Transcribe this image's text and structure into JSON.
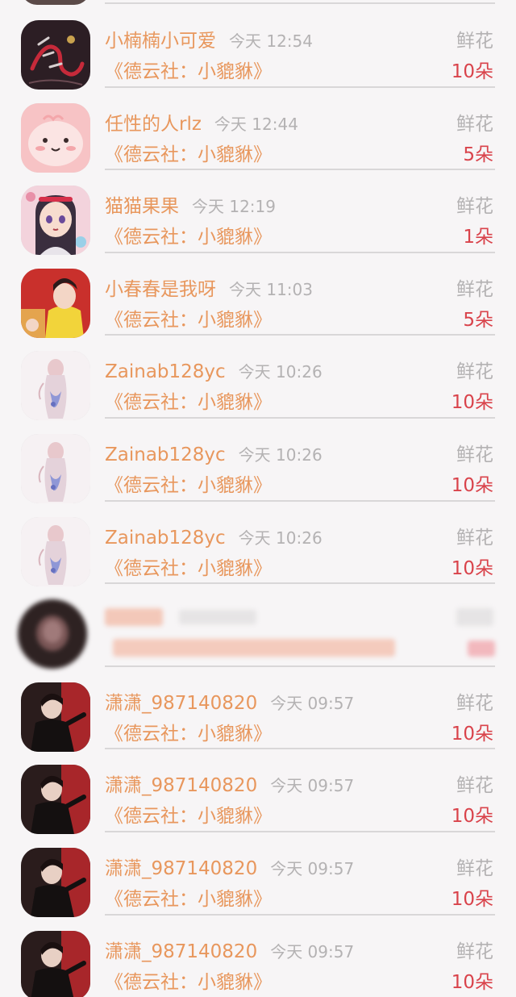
{
  "list": {
    "items": [
      {
        "name": "小楠楠小可爱",
        "time": "今天 12:54",
        "gift": "鲜花",
        "book": "《德云社：小貔貅》",
        "count": "10朵",
        "avatar_icon": "ink-calligraphy-avatar",
        "avatar_color": "#2c1e24"
      },
      {
        "name": "任性的人rlz",
        "time": "今天 12:44",
        "gift": "鲜花",
        "book": "《德云社：小貔貅》",
        "count": "5朵",
        "avatar_icon": "pink-blob-avatar",
        "avatar_color": "#f7c3c5"
      },
      {
        "name": "猫猫果果",
        "time": "今天 12:19",
        "gift": "鲜花",
        "book": "《德云社：小貔貅》",
        "count": "1朵",
        "avatar_icon": "anime-girl-avatar",
        "avatar_color": "#f3b9c8"
      },
      {
        "name": "小春春是我呀",
        "time": "今天 11:03",
        "gift": "鲜花",
        "book": "《德云社：小貔貅》",
        "count": "5朵",
        "avatar_icon": "person-yellow-avatar",
        "avatar_color": "#c9302c"
      },
      {
        "name": "Zainab128yc",
        "time": "今天 10:26",
        "gift": "鲜花",
        "book": "《德云社：小貔貅》",
        "count": "10朵",
        "avatar_icon": "watercolor-figure-avatar",
        "avatar_color": "#f4eef0"
      },
      {
        "name": "Zainab128yc",
        "time": "今天 10:26",
        "gift": "鲜花",
        "book": "《德云社：小貔貅》",
        "count": "10朵",
        "avatar_icon": "watercolor-figure-avatar",
        "avatar_color": "#f4eef0"
      },
      {
        "name": "Zainab128yc",
        "time": "今天 10:26",
        "gift": "鲜花",
        "book": "《德云社：小貔貅》",
        "count": "10朵",
        "avatar_icon": "watercolor-figure-avatar",
        "avatar_color": "#f4eef0"
      },
      {
        "blurred": true,
        "avatar_icon": "blurred-avatar",
        "avatar_color": "#3a2c2c"
      },
      {
        "name": "潇潇_987140820",
        "time": "今天 09:57",
        "gift": "鲜花",
        "book": "《德云社：小貔貅》",
        "count": "10朵",
        "avatar_icon": "stage-performer-avatar",
        "avatar_color": "#2a1c1c"
      },
      {
        "name": "潇潇_987140820",
        "time": "今天 09:57",
        "gift": "鲜花",
        "book": "《德云社：小貔貅》",
        "count": "10朵",
        "avatar_icon": "stage-performer-avatar",
        "avatar_color": "#2a1c1c"
      },
      {
        "name": "潇潇_987140820",
        "time": "今天 09:57",
        "gift": "鲜花",
        "book": "《德云社：小貔貅》",
        "count": "10朵",
        "avatar_icon": "stage-performer-avatar",
        "avatar_color": "#2a1c1c"
      },
      {
        "name": "潇潇_987140820",
        "time": "今天 09:57",
        "gift": "鲜花",
        "book": "《德云社：小貔貅》",
        "count": "10朵",
        "avatar_icon": "stage-performer-avatar",
        "avatar_color": "#2a1c1c"
      }
    ]
  },
  "colors": {
    "name": "#e8975d",
    "meta": "#b4b2b3",
    "count": "#d9434b",
    "divider": "#d9d7d8",
    "background": "#f7f5f6"
  }
}
